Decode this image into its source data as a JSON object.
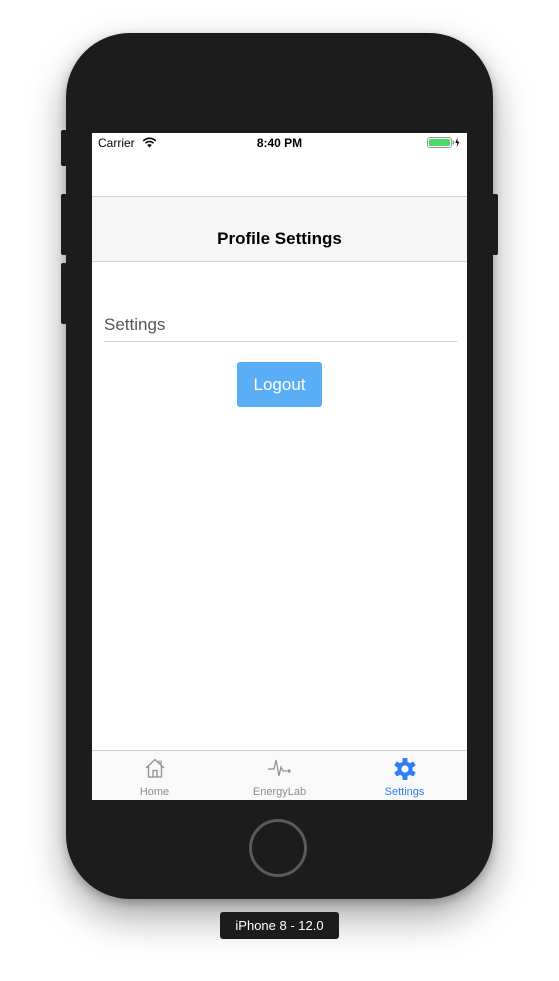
{
  "status_bar": {
    "carrier": "Carrier",
    "time": "8:40 PM"
  },
  "nav": {
    "title": "Profile Settings"
  },
  "content": {
    "section_label": "Settings",
    "logout_label": "Logout"
  },
  "tab_bar": {
    "tabs": [
      {
        "label": "Home",
        "icon": "home-icon",
        "active": false
      },
      {
        "label": "EnergyLab",
        "icon": "pulse-icon",
        "active": false
      },
      {
        "label": "Settings",
        "icon": "gear-icon",
        "active": true
      }
    ],
    "active_color": "#2f7ef5",
    "inactive_color": "#8e8e93"
  },
  "device": {
    "label": "iPhone 8 - 12.0"
  },
  "colors": {
    "button": "#5aaef5",
    "battery": "#4cd964"
  }
}
